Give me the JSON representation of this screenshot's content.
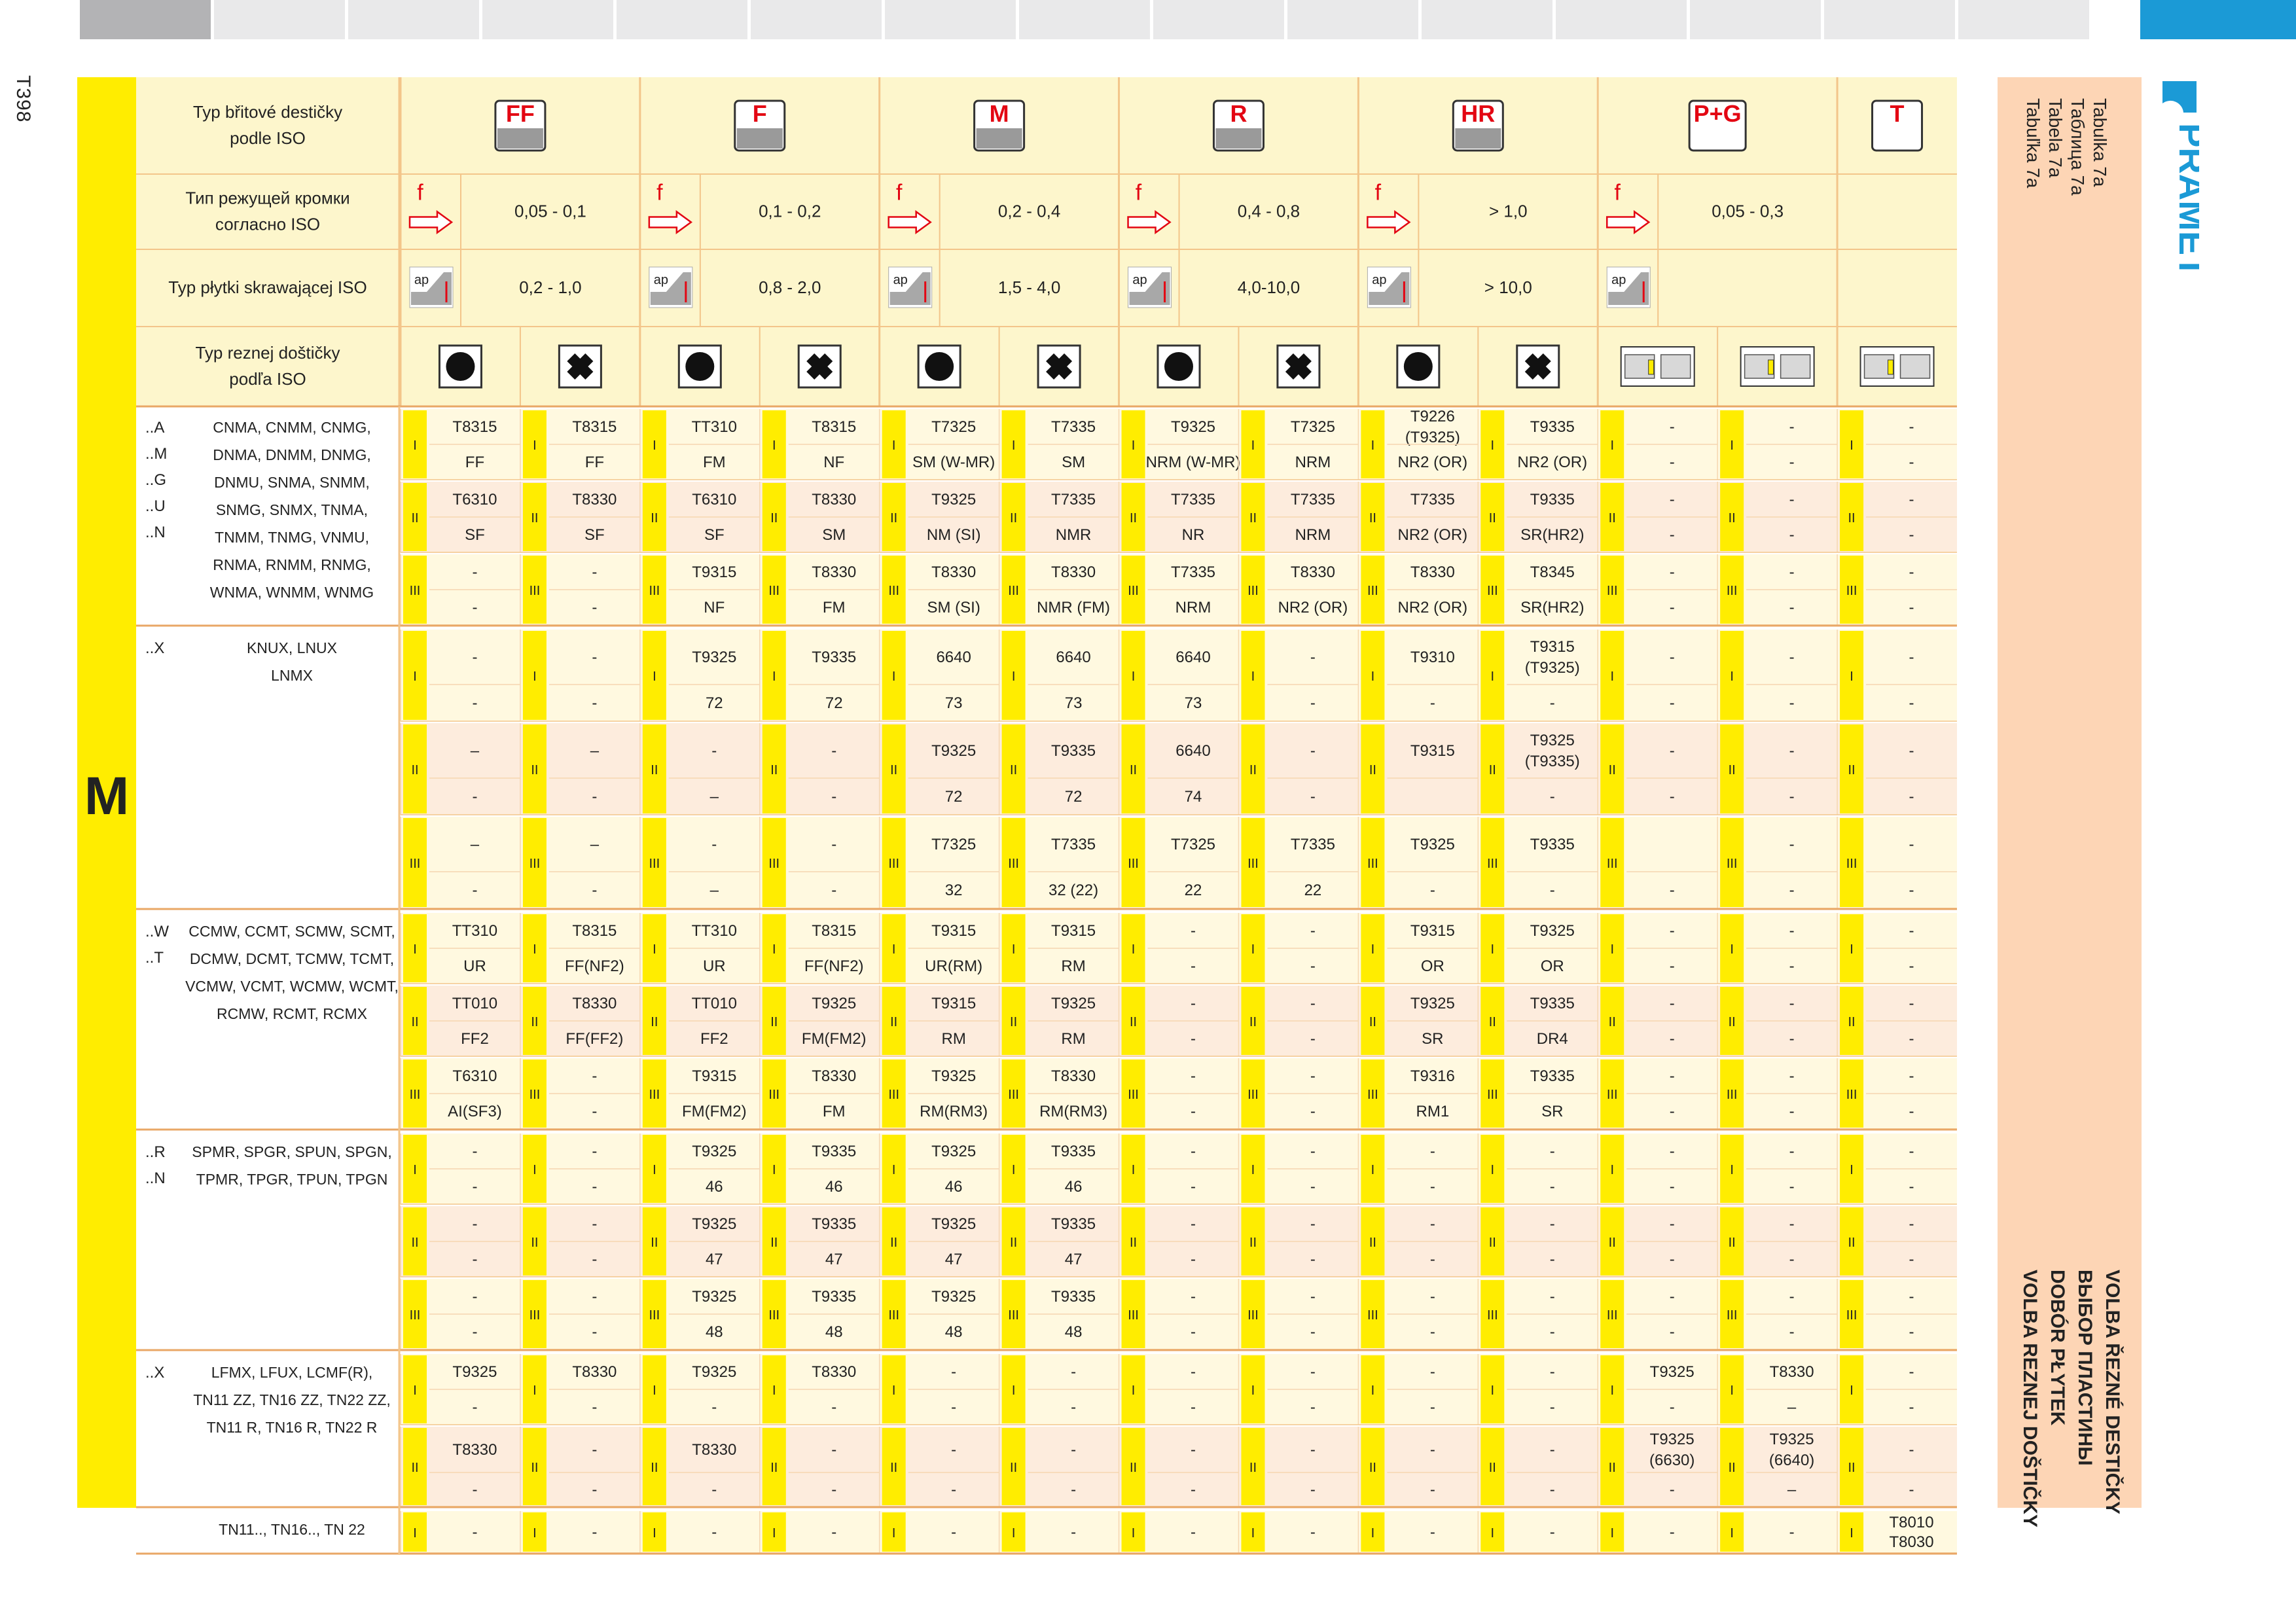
{
  "page": {
    "number": "T398",
    "section_letter": "M",
    "brand": "PRAMET"
  },
  "right_panel": {
    "table_labels": [
      "Tabulka 7a",
      "Таблица 7а",
      "Tabela 7a",
      "Tabuľka 7a"
    ],
    "titles": [
      "VOLBA ŘEZNÉ DESTIČKY",
      "ВЫБОР ПЛАСТИНЫ",
      "DOBÓR PŁYTEK",
      "VOLBA REZNEJ DOŠTIČKY"
    ]
  },
  "header_labels": [
    "Typ břitové destičky podle ISO",
    "Тип режущей кромки согласно ISO",
    "Typ płytki skrawającej ISO",
    "Typ reznej doštičky podľa ISO"
  ],
  "groups": [
    {
      "code": "FF",
      "feed": "0,05 - 0,1",
      "depth": "0,2 - 1,0"
    },
    {
      "code": "F",
      "feed": "0,1 - 0,2",
      "depth": "0,8 - 2,0"
    },
    {
      "code": "M",
      "feed": "0,2 - 0,4",
      "depth": "1,5 - 4,0"
    },
    {
      "code": "R",
      "feed": "0,4 - 0,8",
      "depth": "4,0-10,0"
    },
    {
      "code": "HR",
      "feed": "> 1,0",
      "depth": "> 10,0"
    },
    {
      "code": "P+G",
      "feed": "0,05 - 0,3",
      "depth": ""
    },
    {
      "code": "T",
      "feed": "",
      "depth": ""
    }
  ],
  "icon_names": [
    "no-hole-insert-icon",
    "hole-insert-icon",
    "parting-icon",
    "grooving-icon",
    "profiling-icon",
    "turret-icon",
    "threading-icon"
  ],
  "levels": [
    "I",
    "II",
    "III"
  ],
  "sections": [
    {
      "suffixes": [
        "..A",
        "..M",
        "..G",
        "..U",
        "..N"
      ],
      "types": [
        "CNMA,   CNMM,   CNMG,",
        "DNMA,   DNMM,   DNMG,",
        "DNMU,   SNMA,   SNMM,",
        "SNMG,   SNMX,   TNMA,",
        "TNMM,   TNMG,   VNMU,",
        "RNMA,   RNMM,   RNMG,",
        "WNMA,   WNMM,   WNMG"
      ],
      "rows": [
        {
          "level": "I",
          "top": [
            "T8315",
            "T8315",
            "TT310",
            "T8315",
            "T7325",
            "T7335",
            "T9325",
            "T7325",
            "T9226 (T9325)",
            "T9335",
            "-",
            "-",
            "-"
          ],
          "bottom": [
            "FF",
            "FF",
            "FM",
            "NF",
            "SM (W-MR)",
            "SM",
            "NRM (W-MR)",
            "NRM",
            "NR2 (OR)",
            "NR2 (OR)",
            "-",
            "-",
            "-"
          ]
        },
        {
          "level": "II",
          "top": [
            "T6310",
            "T8330",
            "T6310",
            "T8330",
            "T9325",
            "T7335",
            "T7335",
            "T7335",
            "T7335",
            "T9335",
            "-",
            "-",
            "-"
          ],
          "bottom": [
            "SF",
            "SF",
            "SF",
            "SM",
            "NM (SI)",
            "NMR",
            "NR",
            "NRM",
            "NR2 (OR)",
            "SR(HR2)",
            "-",
            "-",
            "-"
          ]
        },
        {
          "level": "III",
          "top": [
            "-",
            "-",
            "T9315",
            "T8330",
            "T8330",
            "T8330",
            "T7335",
            "T8330",
            "T8330",
            "T8345",
            "-",
            "-",
            "-"
          ],
          "bottom": [
            "-",
            "-",
            "NF",
            "FM",
            "SM (SI)",
            "NMR (FM)",
            "NRM",
            "NR2 (OR)",
            "NR2 (OR)",
            "SR(HR2)",
            "-",
            "-",
            "-"
          ]
        }
      ]
    },
    {
      "suffixes": [
        "..X"
      ],
      "types": [
        "KNUX, LNUX",
        "LNMX"
      ],
      "rows": [
        {
          "level": "I",
          "top": [
            "-",
            "-",
            "T9325",
            "T9335",
            "6640",
            "6640",
            "6640",
            "-",
            "T9310",
            "T9315 (T9325)",
            "-",
            "-",
            "-"
          ],
          "bottom": [
            "-",
            "-",
            "72",
            "72",
            "73",
            "73",
            "73",
            "-",
            "-",
            "-",
            "-",
            "-",
            "-"
          ]
        },
        {
          "level": "II",
          "top": [
            "–",
            "–",
            "-",
            "-",
            "T9325",
            "T9335",
            "6640",
            "-",
            "T9315",
            "T9325 (T9335)",
            "-",
            "-",
            "-"
          ],
          "bottom": [
            "-",
            "-",
            "–",
            "-",
            "72",
            "72",
            "74",
            "-",
            "",
            "-",
            "-",
            "-",
            "-"
          ]
        },
        {
          "level": "III",
          "top": [
            "–",
            "–",
            "-",
            "-",
            "T7325",
            "T7335",
            "T7325",
            "T7335",
            "T9325",
            "T9335",
            "",
            "-",
            "-"
          ],
          "bottom": [
            "-",
            "-",
            "–",
            "-",
            "32",
            "32 (22)",
            "22",
            "22",
            "-",
            "-",
            "-",
            "-",
            "-"
          ]
        }
      ]
    },
    {
      "suffixes": [
        "..W",
        "..T"
      ],
      "types": [
        "CCMW, CCMT, SCMW, SCMT,",
        "DCMW,  DCMT, TCMW,  TCMT,",
        "VCMW, VCMT, WCMW,  WCMT,",
        "RCMW,  RCMT,  RCMX"
      ],
      "rows": [
        {
          "level": "I",
          "top": [
            "TT310",
            "T8315",
            "TT310",
            "T8315",
            "T9315",
            "T9315",
            "-",
            "-",
            "T9315",
            "T9325",
            "-",
            "-",
            "-"
          ],
          "bottom": [
            "UR",
            "FF(NF2)",
            "UR",
            "FF(NF2)",
            "UR(RM)",
            "RM",
            "-",
            "-",
            "OR",
            "OR",
            "-",
            "-",
            "-"
          ]
        },
        {
          "level": "II",
          "top": [
            "TT010",
            "T8330",
            "TT010",
            "T9325",
            "T9315",
            "T9325",
            "-",
            "-",
            "T9325",
            "T9335",
            "-",
            "-",
            "-"
          ],
          "bottom": [
            "FF2",
            "FF(FF2)",
            "FF2",
            "FM(FM2)",
            "RM",
            "RM",
            "-",
            "-",
            "SR",
            "DR4",
            "-",
            "-",
            "-"
          ]
        },
        {
          "level": "III",
          "top": [
            "T6310",
            "-",
            "T9315",
            "T8330",
            "T9325",
            "T8330",
            "-",
            "-",
            "T9316",
            "T9335",
            "-",
            "-",
            "-"
          ],
          "bottom": [
            "AI(SF3)",
            "-",
            "FM(FM2)",
            "FM",
            "RM(RM3)",
            "RM(RM3)",
            "-",
            "-",
            "RM1",
            "SR",
            "-",
            "-",
            "-"
          ]
        }
      ]
    },
    {
      "suffixes": [
        "..R",
        "..N"
      ],
      "types": [
        "SPMR, SPGR, SPUN, SPGN,",
        "TPMR, TPGR, TPUN, TPGN"
      ],
      "rows": [
        {
          "level": "I",
          "top": [
            "-",
            "-",
            "T9325",
            "T9335",
            "T9325",
            "T9335",
            "-",
            "-",
            "-",
            "-",
            "-",
            "-",
            "-"
          ],
          "bottom": [
            "-",
            "-",
            "46",
            "46",
            "46",
            "46",
            "-",
            "-",
            "-",
            "-",
            "-",
            "-",
            "-"
          ]
        },
        {
          "level": "II",
          "top": [
            "-",
            "-",
            "T9325",
            "T9335",
            "T9325",
            "T9335",
            "-",
            "-",
            "-",
            "-",
            "-",
            "-",
            "-"
          ],
          "bottom": [
            "-",
            "-",
            "47",
            "47",
            "47",
            "47",
            "-",
            "-",
            "-",
            "-",
            "-",
            "-",
            "-"
          ]
        },
        {
          "level": "III",
          "top": [
            "-",
            "-",
            "T9325",
            "T9335",
            "T9325",
            "T9335",
            "-",
            "-",
            "-",
            "-",
            "-",
            "-",
            "-"
          ],
          "bottom": [
            "-",
            "-",
            "48",
            "48",
            "48",
            "48",
            "-",
            "-",
            "-",
            "-",
            "-",
            "-",
            "-"
          ]
        }
      ]
    },
    {
      "suffixes": [
        "..X"
      ],
      "types": [
        "LFMX, LFUX, LCMF(R),",
        "TN11 ZZ, TN16 ZZ, TN22 ZZ,",
        "TN11 R, TN16 R, TN22 R"
      ],
      "rows": [
        {
          "level": "I",
          "top": [
            "T9325",
            "T8330",
            "T9325",
            "T8330",
            "-",
            "-",
            "-",
            "-",
            "-",
            "-",
            "T9325",
            "T8330",
            "-"
          ],
          "bottom": [
            "-",
            "-",
            "-",
            "-",
            "-",
            "-",
            "-",
            "-",
            "-",
            "-",
            "-",
            "–",
            "-"
          ]
        },
        {
          "level": "II",
          "top": [
            "T8330",
            "-",
            "T8330",
            "-",
            "-",
            "-",
            "-",
            "-",
            "-",
            "-",
            "T9325 (6630)",
            "T9325 (6640)",
            "-"
          ],
          "bottom": [
            "-",
            "-",
            "-",
            "-",
            "-",
            "-",
            "-",
            "-",
            "-",
            "-",
            "-",
            "–",
            "-"
          ]
        }
      ]
    },
    {
      "suffixes": [],
      "types": [
        "TN11.., TN16.., TN 22"
      ],
      "rows": [
        {
          "level": "I",
          "single": true,
          "top": [
            "-",
            "-",
            "-",
            "-",
            "-",
            "-",
            "-",
            "-",
            "-",
            "-",
            "-",
            "-",
            "T8010 T8030"
          ]
        }
      ]
    }
  ],
  "colors": {
    "header_bg": "#fdf6cc",
    "yellow": "#ffed00",
    "row_light": "#fff9e0",
    "row_alt": "#fdecdd",
    "red": "#e30613",
    "blue": "#1b9ad6",
    "peach": "#fdd5b5"
  }
}
